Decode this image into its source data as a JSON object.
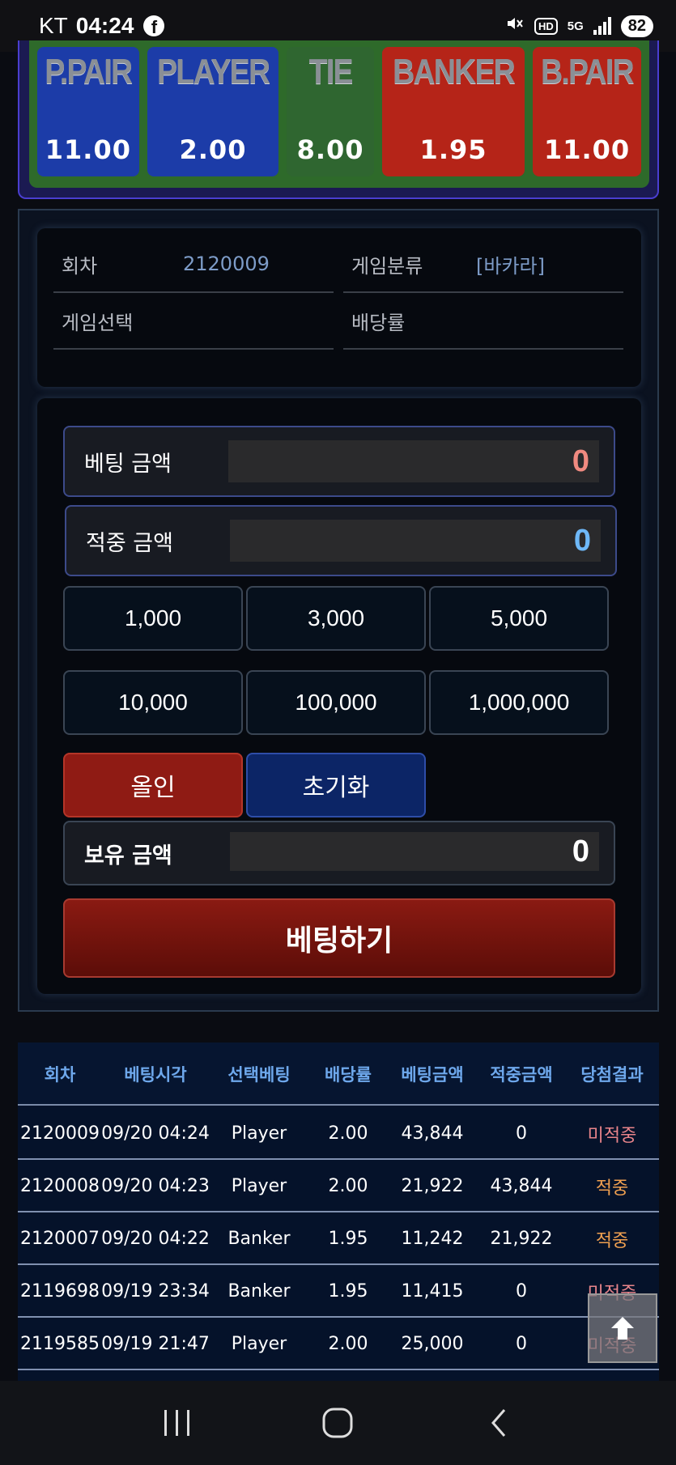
{
  "status_bar": {
    "carrier": "KT",
    "time": "04:24",
    "facebook_glyph": "f",
    "hd_label": "HD",
    "network_label": "5G",
    "battery": "82"
  },
  "bet_options": [
    {
      "name": "P.PAIR",
      "odds": "11.00",
      "color": "#1c3ca8"
    },
    {
      "name": "PLAYER",
      "odds": "2.00",
      "color": "#1c3ca8"
    },
    {
      "name": "TIE",
      "odds": "8.00",
      "color": "#2f6630"
    },
    {
      "name": "BANKER",
      "odds": "1.95",
      "color": "#b52418"
    },
    {
      "name": "B.PAIR",
      "odds": "11.00",
      "color": "#b52418"
    }
  ],
  "game_info": {
    "round_label": "회차",
    "round_value": "2120009",
    "category_label": "게임분류",
    "category_value": "[바카라]",
    "selection_label": "게임선택",
    "selection_value": "",
    "odds_label": "배당률",
    "odds_value": ""
  },
  "amounts": {
    "bet_label": "베팅 금액",
    "bet_value": "0",
    "win_label": "적중 금액",
    "win_value": "0",
    "balance_label": "보유 금액",
    "balance_value": "0"
  },
  "chips": [
    "1,000",
    "3,000",
    "5,000",
    "10,000",
    "100,000",
    "1,000,000"
  ],
  "actions": {
    "allin_label": "올인",
    "reset_label": "초기화",
    "submit_label": "베팅하기"
  },
  "history": {
    "headers": [
      "회차",
      "베팅시각",
      "선택베팅",
      "배당률",
      "베팅금액",
      "적중금액",
      "당첨결과"
    ],
    "rows": [
      [
        "2120009",
        "09/20 04:24",
        "Player",
        "2.00",
        "43,844",
        "0",
        "미적중"
      ],
      [
        "2120008",
        "09/20 04:23",
        "Player",
        "2.00",
        "21,922",
        "43,844",
        "적중"
      ],
      [
        "2120007",
        "09/20 04:22",
        "Banker",
        "1.95",
        "11,242",
        "21,922",
        "적중"
      ],
      [
        "2119698",
        "09/19 23:34",
        "Banker",
        "1.95",
        "11,415",
        "0",
        "미적중"
      ],
      [
        "2119585",
        "09/19 21:47",
        "Player",
        "2.00",
        "25,000",
        "0",
        "미적중"
      ]
    ]
  },
  "colors": {
    "bet_value": "#f08a80",
    "win_value": "#6eb8f8",
    "result_miss": "#e8848a",
    "result_hit": "#f0a050",
    "header_text": "#6ea8ec"
  }
}
